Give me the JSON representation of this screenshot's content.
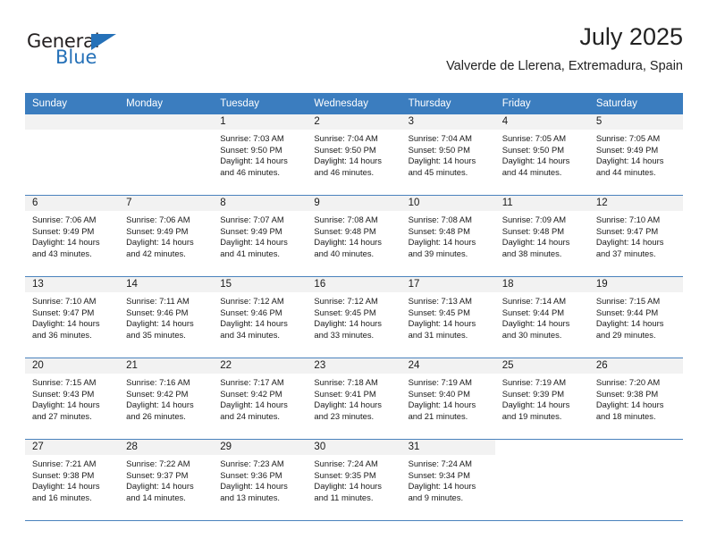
{
  "logo": {
    "word_top": "General",
    "word_bottom": "Blue",
    "triangle_color": "#2571b8",
    "icon": "triangle-icon"
  },
  "header": {
    "title": "July 2025",
    "location": "Valverde de Llerena, Extremadura, Spain"
  },
  "colors": {
    "header_blue": "#3b7dbf",
    "row_separator": "#4a82bd",
    "daynum_band": "#f2f2f2",
    "text": "#1a1a1a",
    "brand_blue": "#2571b8"
  },
  "weekdays": [
    "Sunday",
    "Monday",
    "Tuesday",
    "Wednesday",
    "Thursday",
    "Friday",
    "Saturday"
  ],
  "weeks": [
    [
      {
        "day": "",
        "empty": true
      },
      {
        "day": "",
        "empty": true
      },
      {
        "day": "1",
        "sunrise": "Sunrise: 7:03 AM",
        "sunset": "Sunset: 9:50 PM",
        "daylight_1": "Daylight: 14 hours",
        "daylight_2": "and 46 minutes."
      },
      {
        "day": "2",
        "sunrise": "Sunrise: 7:04 AM",
        "sunset": "Sunset: 9:50 PM",
        "daylight_1": "Daylight: 14 hours",
        "daylight_2": "and 46 minutes."
      },
      {
        "day": "3",
        "sunrise": "Sunrise: 7:04 AM",
        "sunset": "Sunset: 9:50 PM",
        "daylight_1": "Daylight: 14 hours",
        "daylight_2": "and 45 minutes."
      },
      {
        "day": "4",
        "sunrise": "Sunrise: 7:05 AM",
        "sunset": "Sunset: 9:50 PM",
        "daylight_1": "Daylight: 14 hours",
        "daylight_2": "and 44 minutes."
      },
      {
        "day": "5",
        "sunrise": "Sunrise: 7:05 AM",
        "sunset": "Sunset: 9:49 PM",
        "daylight_1": "Daylight: 14 hours",
        "daylight_2": "and 44 minutes."
      }
    ],
    [
      {
        "day": "6",
        "sunrise": "Sunrise: 7:06 AM",
        "sunset": "Sunset: 9:49 PM",
        "daylight_1": "Daylight: 14 hours",
        "daylight_2": "and 43 minutes."
      },
      {
        "day": "7",
        "sunrise": "Sunrise: 7:06 AM",
        "sunset": "Sunset: 9:49 PM",
        "daylight_1": "Daylight: 14 hours",
        "daylight_2": "and 42 minutes."
      },
      {
        "day": "8",
        "sunrise": "Sunrise: 7:07 AM",
        "sunset": "Sunset: 9:49 PM",
        "daylight_1": "Daylight: 14 hours",
        "daylight_2": "and 41 minutes."
      },
      {
        "day": "9",
        "sunrise": "Sunrise: 7:08 AM",
        "sunset": "Sunset: 9:48 PM",
        "daylight_1": "Daylight: 14 hours",
        "daylight_2": "and 40 minutes."
      },
      {
        "day": "10",
        "sunrise": "Sunrise: 7:08 AM",
        "sunset": "Sunset: 9:48 PM",
        "daylight_1": "Daylight: 14 hours",
        "daylight_2": "and 39 minutes."
      },
      {
        "day": "11",
        "sunrise": "Sunrise: 7:09 AM",
        "sunset": "Sunset: 9:48 PM",
        "daylight_1": "Daylight: 14 hours",
        "daylight_2": "and 38 minutes."
      },
      {
        "day": "12",
        "sunrise": "Sunrise: 7:10 AM",
        "sunset": "Sunset: 9:47 PM",
        "daylight_1": "Daylight: 14 hours",
        "daylight_2": "and 37 minutes."
      }
    ],
    [
      {
        "day": "13",
        "sunrise": "Sunrise: 7:10 AM",
        "sunset": "Sunset: 9:47 PM",
        "daylight_1": "Daylight: 14 hours",
        "daylight_2": "and 36 minutes."
      },
      {
        "day": "14",
        "sunrise": "Sunrise: 7:11 AM",
        "sunset": "Sunset: 9:46 PM",
        "daylight_1": "Daylight: 14 hours",
        "daylight_2": "and 35 minutes."
      },
      {
        "day": "15",
        "sunrise": "Sunrise: 7:12 AM",
        "sunset": "Sunset: 9:46 PM",
        "daylight_1": "Daylight: 14 hours",
        "daylight_2": "and 34 minutes."
      },
      {
        "day": "16",
        "sunrise": "Sunrise: 7:12 AM",
        "sunset": "Sunset: 9:45 PM",
        "daylight_1": "Daylight: 14 hours",
        "daylight_2": "and 33 minutes."
      },
      {
        "day": "17",
        "sunrise": "Sunrise: 7:13 AM",
        "sunset": "Sunset: 9:45 PM",
        "daylight_1": "Daylight: 14 hours",
        "daylight_2": "and 31 minutes."
      },
      {
        "day": "18",
        "sunrise": "Sunrise: 7:14 AM",
        "sunset": "Sunset: 9:44 PM",
        "daylight_1": "Daylight: 14 hours",
        "daylight_2": "and 30 minutes."
      },
      {
        "day": "19",
        "sunrise": "Sunrise: 7:15 AM",
        "sunset": "Sunset: 9:44 PM",
        "daylight_1": "Daylight: 14 hours",
        "daylight_2": "and 29 minutes."
      }
    ],
    [
      {
        "day": "20",
        "sunrise": "Sunrise: 7:15 AM",
        "sunset": "Sunset: 9:43 PM",
        "daylight_1": "Daylight: 14 hours",
        "daylight_2": "and 27 minutes."
      },
      {
        "day": "21",
        "sunrise": "Sunrise: 7:16 AM",
        "sunset": "Sunset: 9:42 PM",
        "daylight_1": "Daylight: 14 hours",
        "daylight_2": "and 26 minutes."
      },
      {
        "day": "22",
        "sunrise": "Sunrise: 7:17 AM",
        "sunset": "Sunset: 9:42 PM",
        "daylight_1": "Daylight: 14 hours",
        "daylight_2": "and 24 minutes."
      },
      {
        "day": "23",
        "sunrise": "Sunrise: 7:18 AM",
        "sunset": "Sunset: 9:41 PM",
        "daylight_1": "Daylight: 14 hours",
        "daylight_2": "and 23 minutes."
      },
      {
        "day": "24",
        "sunrise": "Sunrise: 7:19 AM",
        "sunset": "Sunset: 9:40 PM",
        "daylight_1": "Daylight: 14 hours",
        "daylight_2": "and 21 minutes."
      },
      {
        "day": "25",
        "sunrise": "Sunrise: 7:19 AM",
        "sunset": "Sunset: 9:39 PM",
        "daylight_1": "Daylight: 14 hours",
        "daylight_2": "and 19 minutes."
      },
      {
        "day": "26",
        "sunrise": "Sunrise: 7:20 AM",
        "sunset": "Sunset: 9:38 PM",
        "daylight_1": "Daylight: 14 hours",
        "daylight_2": "and 18 minutes."
      }
    ],
    [
      {
        "day": "27",
        "sunrise": "Sunrise: 7:21 AM",
        "sunset": "Sunset: 9:38 PM",
        "daylight_1": "Daylight: 14 hours",
        "daylight_2": "and 16 minutes."
      },
      {
        "day": "28",
        "sunrise": "Sunrise: 7:22 AM",
        "sunset": "Sunset: 9:37 PM",
        "daylight_1": "Daylight: 14 hours",
        "daylight_2": "and 14 minutes."
      },
      {
        "day": "29",
        "sunrise": "Sunrise: 7:23 AM",
        "sunset": "Sunset: 9:36 PM",
        "daylight_1": "Daylight: 14 hours",
        "daylight_2": "and 13 minutes."
      },
      {
        "day": "30",
        "sunrise": "Sunrise: 7:24 AM",
        "sunset": "Sunset: 9:35 PM",
        "daylight_1": "Daylight: 14 hours",
        "daylight_2": "and 11 minutes."
      },
      {
        "day": "31",
        "sunrise": "Sunrise: 7:24 AM",
        "sunset": "Sunset: 9:34 PM",
        "daylight_1": "Daylight: 14 hours",
        "daylight_2": "and 9 minutes."
      },
      {
        "day": "",
        "empty": true,
        "blank_band": true
      },
      {
        "day": "",
        "empty": true,
        "blank_band": true
      }
    ]
  ]
}
